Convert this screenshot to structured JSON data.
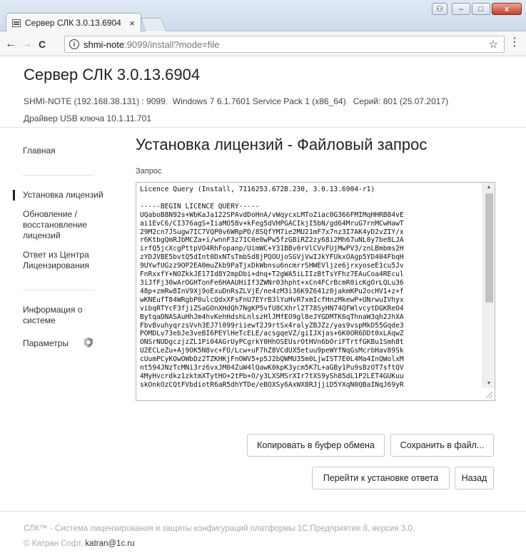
{
  "browser": {
    "tab_title": "Сервер СЛК 3.0.13.6904",
    "tab_close": "×",
    "window_buttons": {
      "user": "⚇",
      "minimize": "–",
      "maximize": "□",
      "close": "x"
    },
    "url_host": "shmi-note",
    "url_rest": ":9099/install?mode=file",
    "nav": {
      "back": "←",
      "forward": "→",
      "reload": "C",
      "info": "i",
      "star": "☆",
      "menu": "⋮"
    }
  },
  "header": {
    "title": "Сервер СЛК 3.0.13.6904",
    "host": "SHMI-NOTE (192.168.38.131) : 9099",
    "os": "Windows 7 6.1.7601 Service Pack 1 (x86_64)",
    "serial": "Серий: 801 (25.07.2017)",
    "driver": "Драйвер USB ключа 10.1.11.701",
    "separator": ","
  },
  "sidebar": {
    "items": [
      {
        "label": "Главная"
      },
      {
        "label": "Установка лицензий"
      },
      {
        "label": "Обновление / восстановление лицензий"
      },
      {
        "label": "Ответ из Центра Лицензирования"
      },
      {
        "label": "Информация о системе"
      },
      {
        "label": "Параметры"
      }
    ]
  },
  "main": {
    "title": "Установка лицензий - Файловый запрос",
    "field_label": "Запрос",
    "request_lines": [
      "Licence Query (Install, 7116253.672B.230, 3.0.13.6904-r1)",
      "",
      "-----BEGIN LICENCE QUERY-----",
      "UQaboB8N92s+WbKaJa122SPAvdDoHnA/vWqycxLMToZiac0G366FMIMqHHRB84vE",
      "ai1EvC6/CI376agS+IiaMO58v+kFeg5dVHPGACIkjI5bN/gd64MruG7rnMCwHawT",
      "29M2cn7JSugw7IC7VQP0v6WRpPD/8SQfYM7ie2MU21mF7x7nz3I7AK4yD2vZIY/x",
      "r6KtbgQmRJbMCZa+i/wnnF3z71C0e0wPw5fzGBiRZ2zy68i2Mh67uNL0y7be8LJA",
      "irfQ5jcXcgPttpVO4RhFopanp/UimWC+Y31BBv0rVlCVvFUjMwPV3/znLBmbms2H",
      "zYDJVBE5bvtQ5dInt0DxNTsTmbSd8jPQOUjoSGVjVwIJkYFUkxOAgp5YD404FbqH",
      "9UYwfUGzz9OP2EA0muZkb9PaTjxDkWbnsu6ncmrrSHWEVljze6jrxyoseE1cu5Jv",
      "FnRxxfY+NOZkkJE17Id8Y2mpDbi+dnq+T2gWA5iLIIzBtTsYFhz7EAuCoa4REcul",
      "3iJfFj30wArOGHTonFe6HAAUHiIf3ZWNr03hpht+xCn4FCrBcmR0icKgOrLQLu36",
      "48p+zmRw8InV9Xj9oExuDnRsZLVjE/ne4zM3i36K9Z641z0jakmKPu2ocHV1+z+f",
      "wKNEufT84WRgbP0ulcQdxXFsFnU7EYrB3lYuHvR7xmIcfHnzMkewP+UNrwuIVhyx",
      "vibqRTYcF3fjiZSaGOnXHdQh7NgKP5vfU8CXhrl2T78SyHN74QFWlvcytDGKReO4",
      "BytqaDNASAuHhJm4hvKehHdshLnlszHlJMfEO9gl8eJYGDMTK6qThnaW3qh2JhXA",
      "FbvBvuhyqrzsVvh3EJ7l099riiewf2J9rtSx4ralyZBJZz/yas9vspMkD55Gqde3",
      "POMDLv73ebJe3veBI6PEYlHeTcELE/acsgqeVZ/giIJXjas+6K0OR6DDt0xLAqwZ",
      "ONSrNUDgczjzZL1Pi04AGrUyPCgrkY0HhOSEUsrOtHVn6bOriFTrtfGKBu1Smh8t",
      "U2ECLeZu+Aj9OK5N8vc+FO/Lcw+uF7hZ8VCdUX5etuu9peWYfNqGsMcrbHav89Sk",
      "cUumPCyKOwOWbDz2TZKHKjFnOWV5+p5J2bQWMU35m0LjwIST7E0L4Ma4InQWolxM",
      "nt594JNzTcMNi3rz6vxJM04ZuW4lQawK0kpK3ycm5K7L+aGBy1Pu9sBzOT7sftQV",
      "4MyHvcrdkz1zktmXTytHO+2tPb+O/y3LXSMSrXIr7tXS9ySh85dL1P2LET4GUKuu",
      "skOnkOzCQtFVbdiotR6aR5dhYTDe/eBOXSy6AxWX8RJjjiD5YXqN0QBaINqJ69yR"
    ]
  },
  "buttons": {
    "copy": "Копировать в буфер обмена",
    "save": "Сохранить в файл...",
    "proceed": "Перейти к установке ответа",
    "back": "Назад"
  },
  "footer": {
    "line1": "СЛК™ - Система лицензирования и защиты конфигураций платформы 1С:Предприятие 8, версия 3.0.",
    "line2_prefix": "© Катран Софт,",
    "email": "katran@1c.ru"
  }
}
